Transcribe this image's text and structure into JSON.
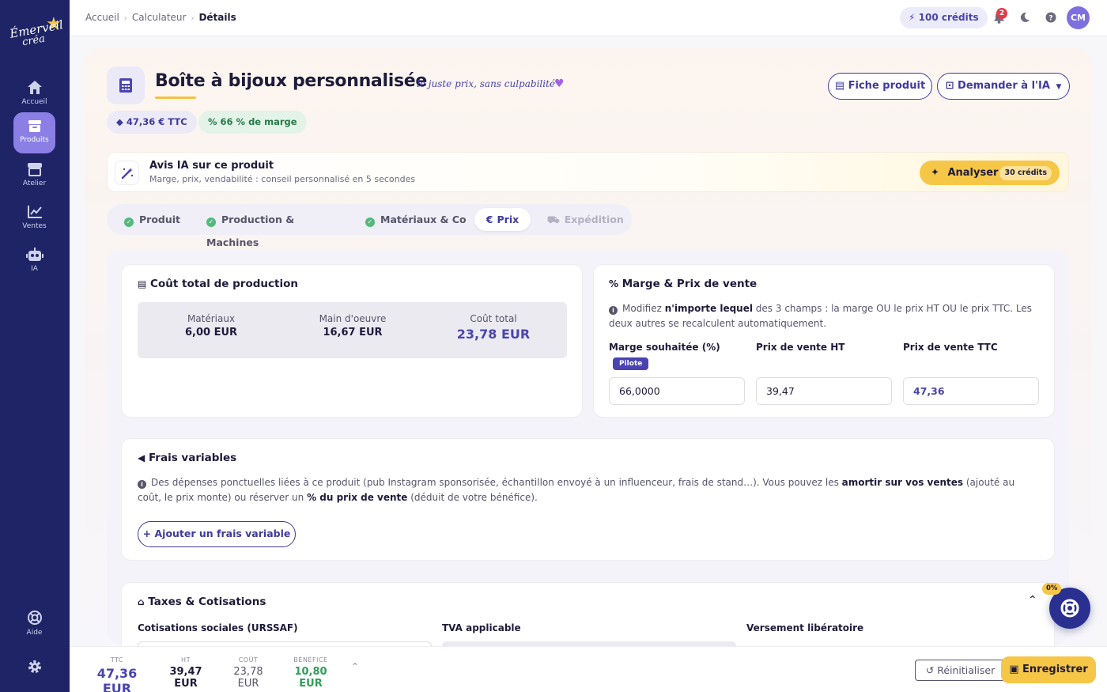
{
  "brand": {
    "line1": "Émerveil",
    "line2": "créa"
  },
  "sidebar": {
    "items": [
      {
        "label": "Accueil",
        "icon": "home-icon"
      },
      {
        "label": "Produits",
        "icon": "box-icon"
      },
      {
        "label": "Atelier",
        "icon": "store-icon"
      },
      {
        "label": "Ventes",
        "icon": "chart-line-icon"
      },
      {
        "label": "IA",
        "icon": "robot-icon"
      }
    ],
    "help_label": "Aide"
  },
  "topbar": {
    "breadcrumb": [
      "Accueil",
      "Calculateur",
      "Détails"
    ],
    "credits": "100 crédits",
    "notifications": "2",
    "avatar": "CM"
  },
  "product": {
    "title": "Boîte à bijoux personnalisée",
    "tagline": "le juste prix, sans culpabilité",
    "price_pill": "47,36 € TTC",
    "margin_pill": "66 % de marge",
    "sheet_button": "Fiche produit",
    "ask_ai_button": "Demander à l'IA"
  },
  "ai_card": {
    "title": "Avis IA sur ce produit",
    "subtitle": "Marge, prix, vendabilité : conseil personnalisé en 5 secondes",
    "button": "Analyser",
    "cost": "30 crédits"
  },
  "tabs": [
    {
      "label": "Produit",
      "state": "done"
    },
    {
      "label": "Production & Machines",
      "state": "done"
    },
    {
      "label": "Matériaux & Co",
      "state": "done"
    },
    {
      "label": "Prix",
      "state": "active"
    },
    {
      "label": "Expédition",
      "state": "disabled"
    }
  ],
  "cost_card": {
    "title": "Coût total de production",
    "items": [
      {
        "label": "Matériaux",
        "value": "6,00 EUR"
      },
      {
        "label": "Main d'oeuvre",
        "value": "16,67 EUR"
      },
      {
        "label": "Coût total",
        "value": "23,78 EUR"
      }
    ]
  },
  "margin_card": {
    "title": "Marge & Prix de vente",
    "info_pre": "Modifiez ",
    "info_bold": "n'importe lequel",
    "info_post": " des 3 champs : la marge OU le prix HT OU le prix TTC. Les deux autres se recalculent automatiquement.",
    "fields": [
      {
        "label": "Marge souhaitée (%)",
        "value": "66,0000"
      },
      {
        "label": "Prix de vente HT",
        "value": "39,47"
      },
      {
        "label": "Prix de vente TTC",
        "value": "47,36"
      }
    ],
    "pilot_badge": "Pilote"
  },
  "variable_costs": {
    "title": "Frais variables",
    "info_1": "Des dépenses ponctuelles liées à ce produit (pub Instagram sponsorisée, échantillon envoyé à un influenceur, frais de stand…). Vous pouvez les ",
    "info_b1": "amortir sur vos ventes",
    "info_2": " (ajouté au coût, le prix monte) ou réserver un ",
    "info_b2": "% du prix de vente",
    "info_3": " (déduit de votre bénéfice).",
    "add_button": "+ Ajouter un frais variable"
  },
  "taxes": {
    "title": "Taxes & Cotisations",
    "labels": [
      "Cotisations sociales (URSSAF)",
      "TVA applicable",
      "Versement libératoire"
    ]
  },
  "help_badge": "0%",
  "bottom": {
    "summary": [
      {
        "key": "TTC",
        "value": "47,36 EUR"
      },
      {
        "key": "HT",
        "value": "39,47 EUR"
      },
      {
        "key": "COÛT",
        "value": "23,78 EUR"
      },
      {
        "key": "BÉNÉFICE",
        "value": "10,80 EUR"
      }
    ],
    "reset_button": "Réinitialiser",
    "save_button": "Enregistrer"
  },
  "colors": {
    "primary": "#1e2466",
    "accent": "#f6c646",
    "brand_purple": "#4a44b0",
    "success": "#2e9e5a"
  }
}
